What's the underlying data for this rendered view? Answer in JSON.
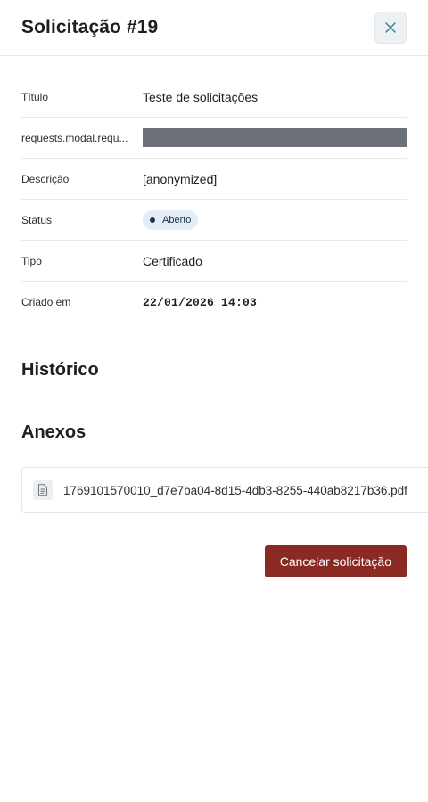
{
  "modal": {
    "title": "Solicitação #19"
  },
  "details": [
    {
      "label": "Título",
      "value": "Teste de solicitações"
    },
    {
      "label": "requests.modal.requ...",
      "value": ""
    },
    {
      "label": "Descrição",
      "value": "[anonymized]"
    },
    {
      "label": "Status",
      "value": "Aberto"
    },
    {
      "label": "Tipo",
      "value": "Certificado"
    },
    {
      "label": "Criado em",
      "value": "22/01/2026 14:03"
    }
  ],
  "sections": {
    "history_title": "Histórico",
    "attachments_title": "Anexos"
  },
  "attachments": [
    {
      "name": "1769101570010_d7e7ba04-8d15-4db3-8255-440ab8217b36.pdf",
      "icon": "file-text-icon"
    }
  ],
  "actions": {
    "cancel_label": "Cancelar solicitação"
  },
  "colors": {
    "danger": "#8b2a23",
    "status_badge_bg": "#e3edf7",
    "close_icon": "#2a7f8f"
  }
}
